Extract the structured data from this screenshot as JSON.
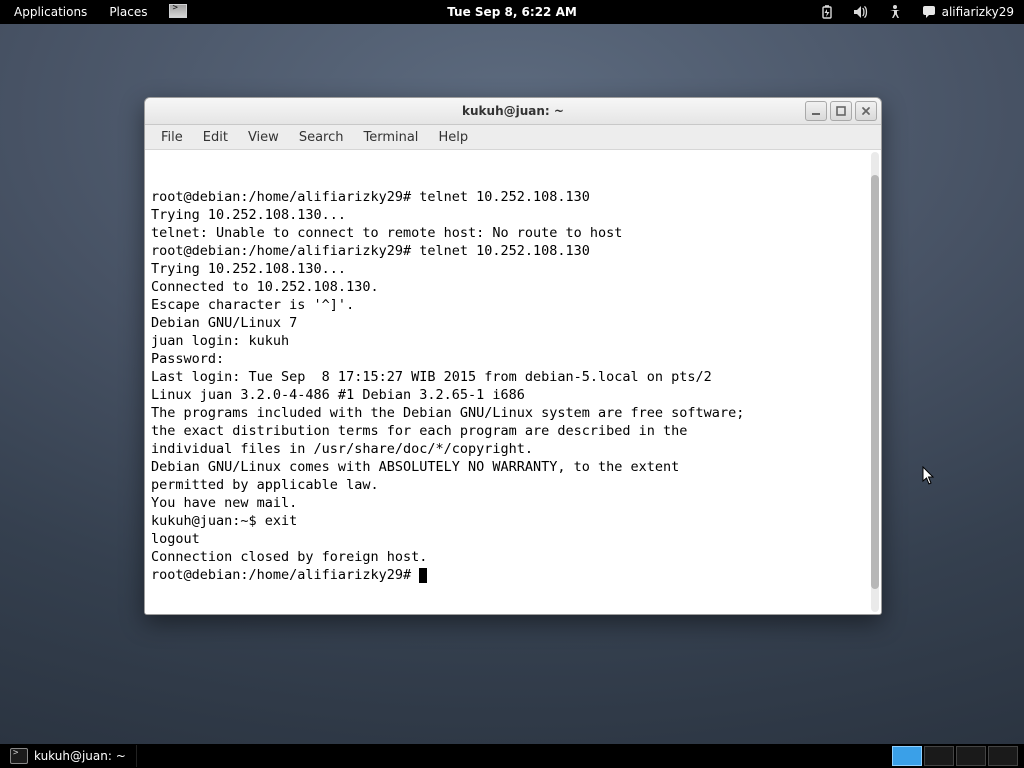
{
  "top_panel": {
    "applications": "Applications",
    "places": "Places",
    "clock": "Tue Sep  8,  6:22 AM",
    "user": "alifiarizky29"
  },
  "bottom_panel": {
    "task_label": "kukuh@juan: ~"
  },
  "window": {
    "title": "kukuh@juan: ~",
    "menus": {
      "file": "File",
      "edit": "Edit",
      "view": "View",
      "search": "Search",
      "terminal": "Terminal",
      "help": "Help"
    }
  },
  "terminal_lines": [
    "root@debian:/home/alifiarizky29# telnet 10.252.108.130",
    "Trying 10.252.108.130...",
    "telnet: Unable to connect to remote host: No route to host",
    "root@debian:/home/alifiarizky29# telnet 10.252.108.130",
    "Trying 10.252.108.130...",
    "Connected to 10.252.108.130.",
    "Escape character is '^]'.",
    "Debian GNU/Linux 7",
    "juan login: kukuh",
    "Password:",
    "Last login: Tue Sep  8 17:15:27 WIB 2015 from debian-5.local on pts/2",
    "Linux juan 3.2.0-4-486 #1 Debian 3.2.65-1 i686",
    "",
    "The programs included with the Debian GNU/Linux system are free software;",
    "the exact distribution terms for each program are described in the",
    "individual files in /usr/share/doc/*/copyright.",
    "",
    "Debian GNU/Linux comes with ABSOLUTELY NO WARRANTY, to the extent",
    "permitted by applicable law.",
    "You have new mail.",
    "kukuh@juan:~$ exit",
    "logout",
    "Connection closed by foreign host."
  ],
  "terminal_prompt": "root@debian:/home/alifiarizky29# "
}
